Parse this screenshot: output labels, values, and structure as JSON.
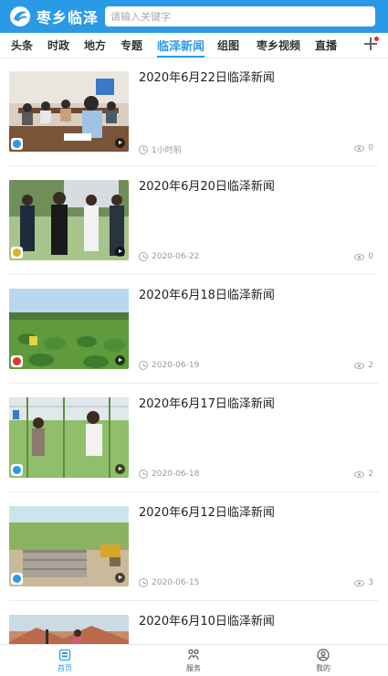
{
  "header": {
    "app_name": "枣乡临泽",
    "search_placeholder": "请输入关键字",
    "brand_color": "#2b9ae6"
  },
  "tabs": [
    {
      "label": "头条"
    },
    {
      "label": "时政"
    },
    {
      "label": "地方"
    },
    {
      "label": "专题"
    },
    {
      "label": "临泽新闻",
      "active": true
    },
    {
      "label": "组图"
    },
    {
      "label": "枣乡视频"
    },
    {
      "label": "直播"
    }
  ],
  "feed": [
    {
      "title": "2020年6月22日临泽新闻",
      "time": "1小时前",
      "views": "0",
      "thumb": "meeting-room"
    },
    {
      "title": "2020年6月20日临泽新闻",
      "time": "2020-06-22",
      "views": "0",
      "thumb": "officials-outdoors"
    },
    {
      "title": "2020年6月18日临泽新闻",
      "time": "2020-06-19",
      "views": "2",
      "thumb": "crop-field"
    },
    {
      "title": "2020年6月17日临泽新闻",
      "time": "2020-06-18",
      "views": "2",
      "thumb": "greenhouse"
    },
    {
      "title": "2020年6月12日临泽新闻",
      "time": "2020-06-15",
      "views": "3",
      "thumb": "brick-construction"
    },
    {
      "title": "2020年6月10日临泽新闻",
      "time": "",
      "views": "",
      "thumb": "red-cliffs"
    }
  ],
  "bottom_nav": [
    {
      "label": "首页",
      "icon": "home-icon",
      "active": true
    },
    {
      "label": "服务",
      "icon": "service-icon"
    },
    {
      "label": "我的",
      "icon": "profile-icon"
    }
  ]
}
